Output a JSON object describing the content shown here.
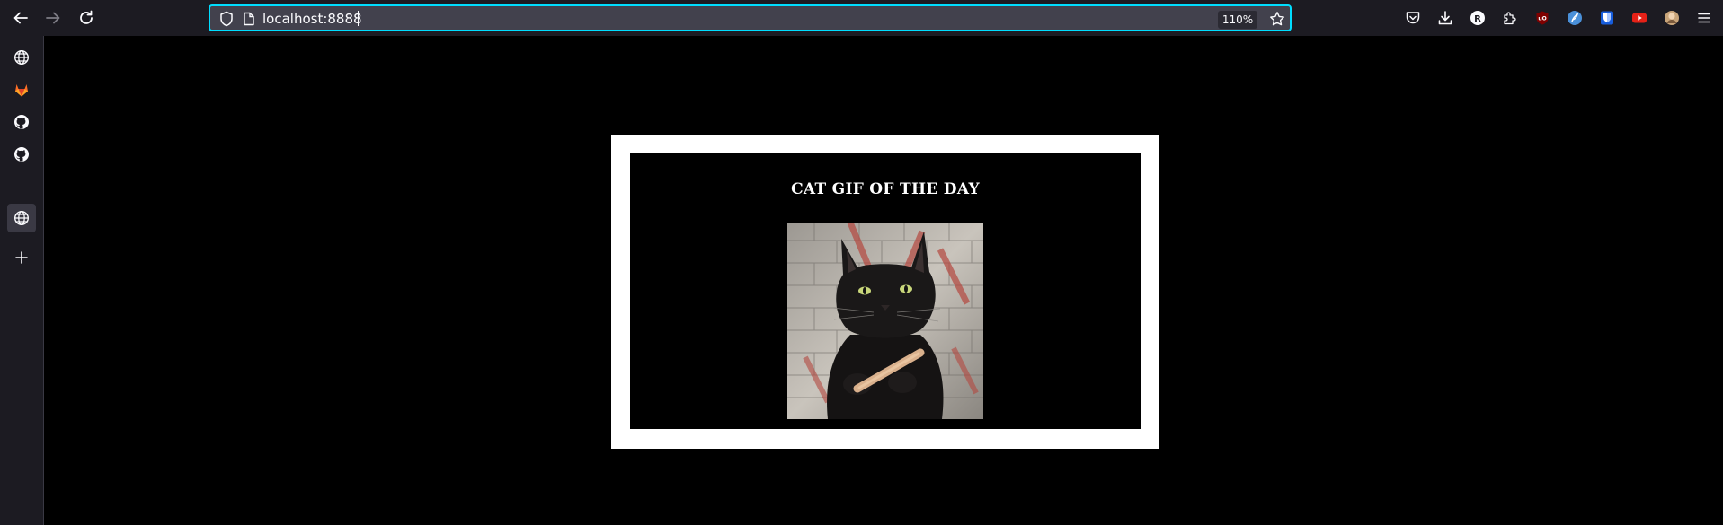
{
  "browser": {
    "url": "localhost:8888",
    "zoom": "110%",
    "icons": {
      "back": "arrow-left-icon",
      "forward": "arrow-right-icon",
      "reload": "reload-icon",
      "shield": "shield-icon",
      "page": "page-icon",
      "bookmark": "star-icon",
      "pocket": "pocket-icon",
      "downloads": "download-icon",
      "extensions": "puzzle-icon",
      "menu": "hamburger-menu-icon"
    },
    "accent_color": "#00ddff"
  },
  "sidebar": {
    "items": [
      {
        "name": "globe-icon"
      },
      {
        "name": "gitlab-icon"
      },
      {
        "name": "github-icon"
      },
      {
        "name": "github-icon"
      },
      {
        "name": "globe-icon",
        "active": true
      },
      {
        "name": "plus-icon"
      }
    ]
  },
  "page": {
    "heading": "CAT GIF OF THE DAY",
    "image_name": "cat-gif-image"
  }
}
